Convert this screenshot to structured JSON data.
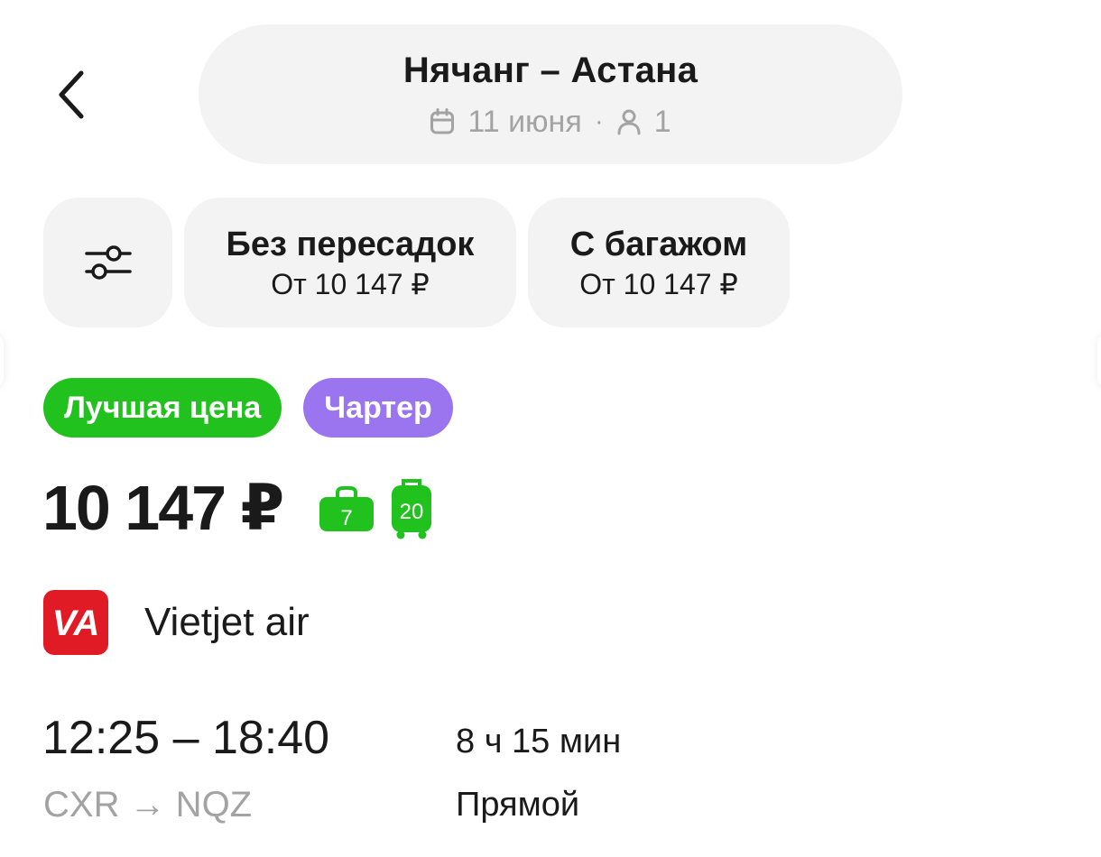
{
  "header": {
    "back_icon": "chevron-left-icon",
    "route_title": "Нячанг – Астана",
    "date": "11 июня",
    "separator": "·",
    "passengers": "1",
    "calendar_icon": "calendar-icon",
    "person_icon": "person-icon"
  },
  "filters": {
    "settings_icon": "sliders-icon",
    "chips": [
      {
        "title": "Без пересадок",
        "subtitle": "От 10 147 ₽"
      },
      {
        "title": "С багажом",
        "subtitle": "От 10 147 ₽"
      }
    ]
  },
  "offer": {
    "badges": [
      {
        "label": "Лучшая цена",
        "color": "#21c21d"
      },
      {
        "label": "Чартер",
        "color": "#9b74ef"
      }
    ],
    "price": "10 147 ₽",
    "hand_luggage_kg": "7",
    "checked_baggage_kg": "20",
    "baggage_color": "#21c21d",
    "airline": {
      "logo_text": "VA",
      "name": "Vietjet air",
      "logo_color": "#e01b25"
    },
    "times": "12:25 – 18:40",
    "airports": "CXR → NQZ",
    "duration": "8 ч 15 мин",
    "stops": "Прямой"
  }
}
